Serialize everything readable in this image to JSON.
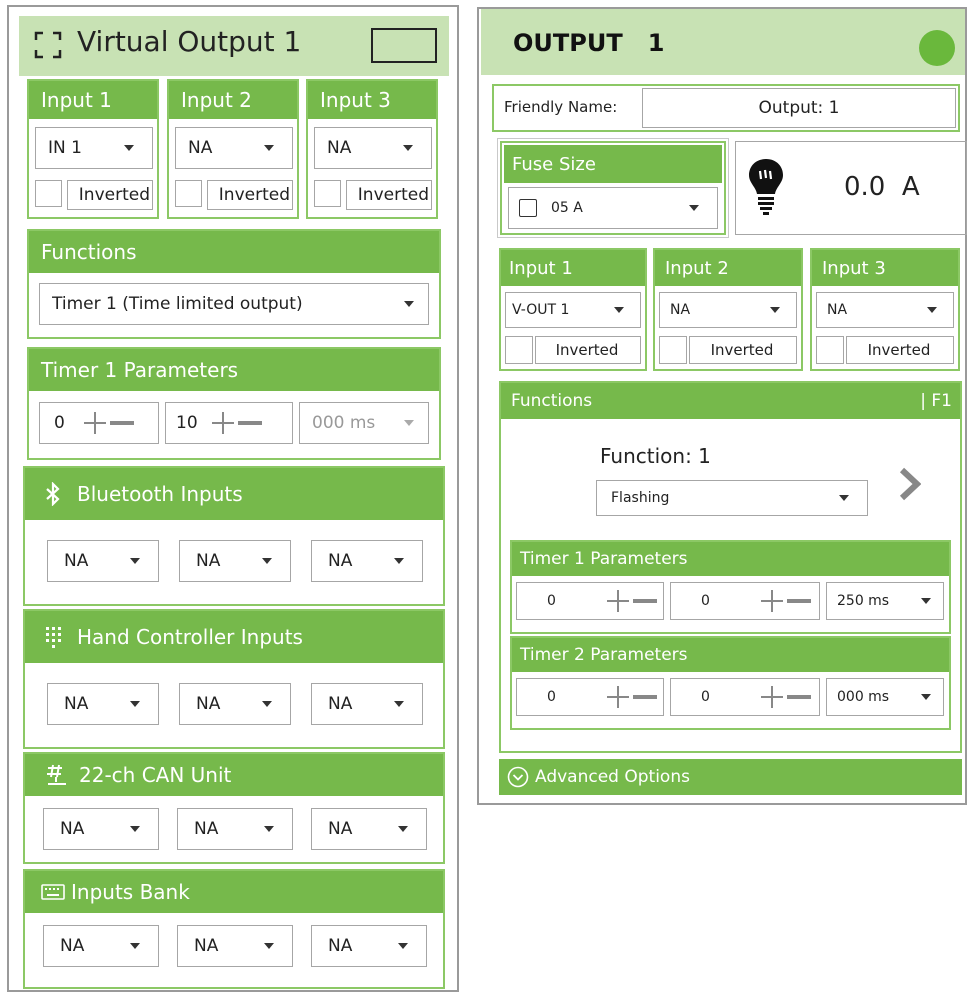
{
  "left": {
    "title": "Virtual Output 1",
    "inputs": [
      {
        "label": "Input 1",
        "value": "IN 1",
        "inverted": "Inverted"
      },
      {
        "label": "Input 2",
        "value": "NA",
        "inverted": "Inverted"
      },
      {
        "label": "Input 3",
        "value": "NA",
        "inverted": "Inverted"
      }
    ],
    "functions_label": "Functions",
    "function_value": "Timer 1 (Time limited output)",
    "timer1_label": "Timer 1 Parameters",
    "timer1": {
      "a": "0",
      "b": "10",
      "unit": "000 ms"
    },
    "bluetooth": {
      "label": "Bluetooth Inputs",
      "values": [
        "NA",
        "NA",
        "NA"
      ]
    },
    "hand": {
      "label": "Hand Controller Inputs",
      "values": [
        "NA",
        "NA",
        "NA"
      ]
    },
    "can": {
      "label": "22-ch CAN Unit",
      "values": [
        "NA",
        "NA",
        "NA"
      ]
    },
    "bank": {
      "label": "Inputs Bank",
      "values": [
        "NA",
        "NA",
        "NA"
      ]
    }
  },
  "right": {
    "title": "OUTPUT   1",
    "status_color": "#6ab83c",
    "friendly_label": "Friendly Name:",
    "friendly_value": "Output: 1",
    "fuse_label": "Fuse Size",
    "fuse_value": "05 A",
    "current": "0.0  A",
    "inputs": [
      {
        "label": "Input 1",
        "value": "V-OUT 1",
        "inverted": "Inverted"
      },
      {
        "label": "Input 2",
        "value": "NA",
        "inverted": "Inverted"
      },
      {
        "label": "Input 3",
        "value": "NA",
        "inverted": "Inverted"
      }
    ],
    "functions_label": "Functions",
    "functions_tag": "| F1",
    "function_title": "Function: 1",
    "function_value": "Flashing",
    "timer1_label": "Timer 1 Parameters",
    "timer1": {
      "a": "0",
      "b": "0",
      "unit": "250 ms"
    },
    "timer2_label": "Timer 2 Parameters",
    "timer2": {
      "a": "0",
      "b": "0",
      "unit": "000 ms"
    },
    "advanced": "Advanced Options"
  },
  "colors": {
    "accent": "#76b94b",
    "accent_light": "#c8e2b4",
    "border": "#8cc865"
  }
}
